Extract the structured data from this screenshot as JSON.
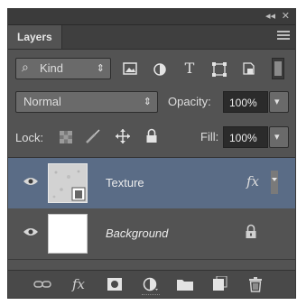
{
  "titlebar": {
    "collapse_glyph": "◂◂",
    "close_glyph": "✕"
  },
  "tabs": [
    {
      "label": "Layers"
    }
  ],
  "filter": {
    "kind_label": "Kind",
    "search_glyph": "⌕",
    "stepper_glyph": "⇕",
    "filter_icons": [
      "image-filter-icon",
      "adjustment-filter-icon",
      "type-filter-icon",
      "shape-filter-icon",
      "smart-object-filter-icon"
    ]
  },
  "blend": {
    "mode": "Normal",
    "stepper_glyph": "⇕",
    "opacity_label": "Opacity:",
    "opacity_value": "100%",
    "dropdown_glyph": "▾"
  },
  "lock": {
    "label": "Lock:",
    "fill_label": "Fill:",
    "fill_value": "100%",
    "dropdown_glyph": "▾",
    "lock_icons": [
      "lock-transparent-icon",
      "lock-image-icon",
      "lock-position-icon",
      "lock-all-icon"
    ]
  },
  "layers": [
    {
      "name": "Texture",
      "selected": true,
      "fx": "fx",
      "visible": true
    },
    {
      "name": "Background",
      "selected": false,
      "locked": true,
      "visible": true
    }
  ],
  "bottom_icons": [
    "link-layers-icon",
    "fx-icon",
    "mask-icon",
    "adjustment-icon",
    "group-folder-icon",
    "new-layer-icon",
    "trash-icon"
  ],
  "bottom_fx_label": "fx",
  "colors": {
    "panel": "#535353",
    "selected_row": "#5a6c86",
    "field": "#2b2b2b"
  }
}
